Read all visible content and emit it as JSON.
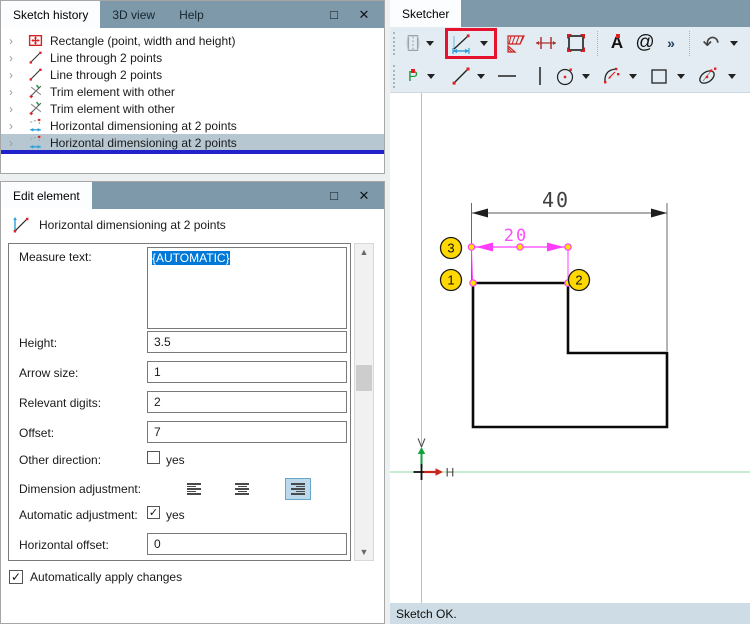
{
  "icons": {
    "maximize": "□",
    "close": "✕",
    "chevron": "›",
    "check": "✓",
    "scroll_up": "▲",
    "scroll_down": "▼",
    "more": "»",
    "undo": "↶",
    "at_symbol": "@",
    "text_tool_glyph": "A",
    "point_tool_glyph": "P"
  },
  "sketch_history": {
    "tabs": [
      {
        "label": "Sketch history",
        "active": true
      },
      {
        "label": "3D view",
        "active": false
      },
      {
        "label": "Help",
        "active": false
      }
    ],
    "items": [
      {
        "label": "Rectangle (point, width and height)",
        "icon": "rectangle-move-icon",
        "selected": false
      },
      {
        "label": "Line through 2 points",
        "icon": "line-icon",
        "selected": false
      },
      {
        "label": "Line through 2 points",
        "icon": "line-icon",
        "selected": false
      },
      {
        "label": "Trim element with other",
        "icon": "trim-icon",
        "selected": false
      },
      {
        "label": "Trim element with other",
        "icon": "trim-icon",
        "selected": false
      },
      {
        "label": "Horizontal dimensioning at 2 points",
        "icon": "horizontal-dimension-icon",
        "selected": false
      },
      {
        "label": "Horizontal dimensioning at 2 points",
        "icon": "horizontal-dimension-icon",
        "selected": true
      }
    ]
  },
  "edit_element": {
    "title": "Edit element",
    "header": "Horizontal dimensioning at 2 points",
    "fields": {
      "measure_text": {
        "label": "Measure text:",
        "value": "{AUTOMATIC}",
        "text_selected": true
      },
      "height": {
        "label": "Height:",
        "value": "3.5"
      },
      "arrow_size": {
        "label": "Arrow size:",
        "value": "1"
      },
      "relevant_digits": {
        "label": "Relevant digits:",
        "value": "2"
      },
      "offset": {
        "label": "Offset:",
        "value": "7"
      },
      "other_direction": {
        "label": "Other direction:",
        "option": "yes",
        "checked": false
      },
      "dimension_adjustment": {
        "label": "Dimension adjustment:",
        "options": [
          "align-left",
          "align-center",
          "align-right"
        ],
        "selected": "align-right"
      },
      "automatic_adjustment": {
        "label": "Automatic adjustment:",
        "option": "yes",
        "checked": true
      },
      "horizontal_offset": {
        "label": "Horizontal offset:",
        "value": "0"
      }
    },
    "footer_checkbox": {
      "label": "Automatically apply changes",
      "checked": true
    }
  },
  "sketcher": {
    "tab": "Sketcher",
    "status": "Sketch OK.",
    "toolbar_row1": [
      {
        "name": "extrude-tool",
        "disabled": true,
        "has_dropdown": true
      },
      {
        "name": "horizontal-dimension-tool",
        "active": true,
        "highlight": "red-box",
        "has_dropdown": true
      },
      {
        "name": "hatch-tool"
      },
      {
        "name": "symmetry-dimension-tool"
      },
      {
        "name": "frame-tool"
      },
      {
        "name": "text-tool",
        "glyph": "A"
      },
      {
        "name": "symbol-tool",
        "glyph": "@"
      },
      {
        "name": "more-tools",
        "glyph": "»"
      },
      {
        "name": "undo",
        "glyph": "↶",
        "has_dropdown": true
      }
    ],
    "toolbar_row2": [
      {
        "name": "point-tool",
        "glyph": "P",
        "has_dropdown": true
      },
      {
        "name": "line-tool",
        "has_dropdown": true
      },
      {
        "name": "horizontal-line-tool"
      },
      {
        "name": "vertical-line-tool"
      },
      {
        "name": "circle-tool",
        "has_dropdown": true
      },
      {
        "name": "arc-tool",
        "has_dropdown": true
      },
      {
        "name": "rectangle-tool",
        "has_dropdown": true
      },
      {
        "name": "ellipse-tool",
        "has_dropdown": true
      }
    ],
    "canvas": {
      "dim40": {
        "label": "40",
        "color": "#3f3f3f"
      },
      "dim20": {
        "label": "20",
        "color": "#ff4dff"
      },
      "balloons": [
        {
          "n": "3"
        },
        {
          "n": "1"
        },
        {
          "n": "2"
        }
      ],
      "axis_labels": {
        "v": "V",
        "h": "H"
      }
    }
  },
  "colors": {
    "titlebar": "#7e9aaa",
    "toolbar_bg": "#e2ecf2",
    "selection_blue": "#0078d7",
    "selected_row": "#b7c7d1",
    "underline_blue": "#2222cc",
    "status_bg": "#cedde5",
    "highlight_red": "#e8112d",
    "magenta": "#ff3dff",
    "balloon_yellow": "#ffd800",
    "axis_green": "#90d9a6"
  }
}
